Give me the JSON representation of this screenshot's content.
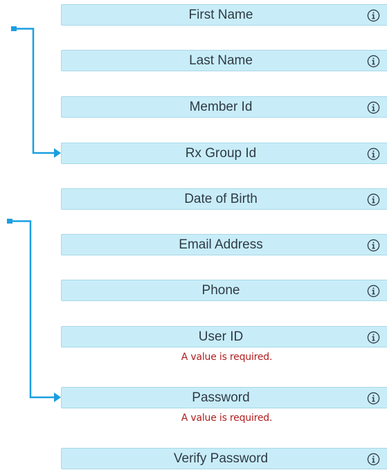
{
  "form": {
    "fields": [
      {
        "label": "First Name",
        "info_icon": "info-icon"
      },
      {
        "label": "Last Name",
        "info_icon": "info-icon"
      },
      {
        "label": "Member Id",
        "info_icon": "info-icon"
      },
      {
        "label": "Rx Group Id",
        "info_icon": "info-icon"
      },
      {
        "label": "Date of Birth",
        "info_icon": "info-icon"
      },
      {
        "label": "Email Address",
        "info_icon": "info-icon"
      },
      {
        "label": "Phone",
        "info_icon": "info-icon"
      },
      {
        "label": "User ID",
        "info_icon": "info-icon",
        "error": "A value is required."
      },
      {
        "label": "Password",
        "info_icon": "info-icon",
        "error": "A value is required."
      },
      {
        "label": "Verify Password",
        "info_icon": "info-icon"
      }
    ]
  },
  "colors": {
    "field_bg": "#c8edf8",
    "connector": "#1a9fe0",
    "error_text": "#b01c1c"
  }
}
